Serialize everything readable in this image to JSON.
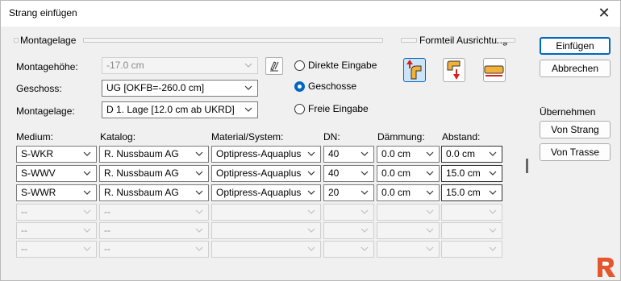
{
  "window": {
    "title": "Strang einfügen"
  },
  "montage": {
    "group_label": "Montagelage",
    "height_label": "Montagehöhe:",
    "height_value": "-17.0 cm",
    "floor_label": "Geschoss:",
    "floor_value": "UG  [OKFB=-260.0 cm]",
    "layer_label": "Montagelage:",
    "layer_value": "D 1. Lage  [12.0 cm ab UKRD]"
  },
  "mode": {
    "options": [
      {
        "label": "Direkte Eingabe",
        "checked": false
      },
      {
        "label": "Geschosse",
        "checked": true
      },
      {
        "label": "Freie Eingabe",
        "checked": false
      }
    ]
  },
  "orientation": {
    "group_label": "Formteil Ausrichtung"
  },
  "actions": {
    "insert": "Einfügen",
    "cancel": "Abbrechen",
    "adopt_label": "Übernehmen",
    "from_strand": "Von Strang",
    "from_route": "Von Trasse"
  },
  "table": {
    "headers": {
      "medium": "Medium:",
      "catalog": "Katalog:",
      "material": "Material/System:",
      "dn": "DN:",
      "insulation": "Dämmung:",
      "distance": "Abstand:"
    },
    "rows": [
      {
        "medium": "S-WKR",
        "catalog": "R. Nussbaum AG",
        "material": "Optipress-Aquaplus",
        "dn": "40",
        "insulation": "0.0 cm",
        "distance": "0.0 cm",
        "enabled": true
      },
      {
        "medium": "S-WWV",
        "catalog": "R. Nussbaum AG",
        "material": "Optipress-Aquaplus",
        "dn": "40",
        "insulation": "0.0 cm",
        "distance": "15.0 cm",
        "enabled": true
      },
      {
        "medium": "S-WWR",
        "catalog": "R. Nussbaum AG",
        "material": "Optipress-Aquaplus",
        "dn": "20",
        "insulation": "0.0 cm",
        "distance": "15.0 cm",
        "enabled": true
      },
      {
        "medium": "--",
        "catalog": "--",
        "material": "",
        "dn": "",
        "insulation": "",
        "distance": "",
        "enabled": false
      },
      {
        "medium": "--",
        "catalog": "--",
        "material": "",
        "dn": "",
        "insulation": "",
        "distance": "",
        "enabled": false
      },
      {
        "medium": "--",
        "catalog": "--",
        "material": "",
        "dn": "",
        "insulation": "",
        "distance": "",
        "enabled": false
      }
    ]
  },
  "colors": {
    "accent": "#0067c0",
    "logo": "#e4572e"
  }
}
